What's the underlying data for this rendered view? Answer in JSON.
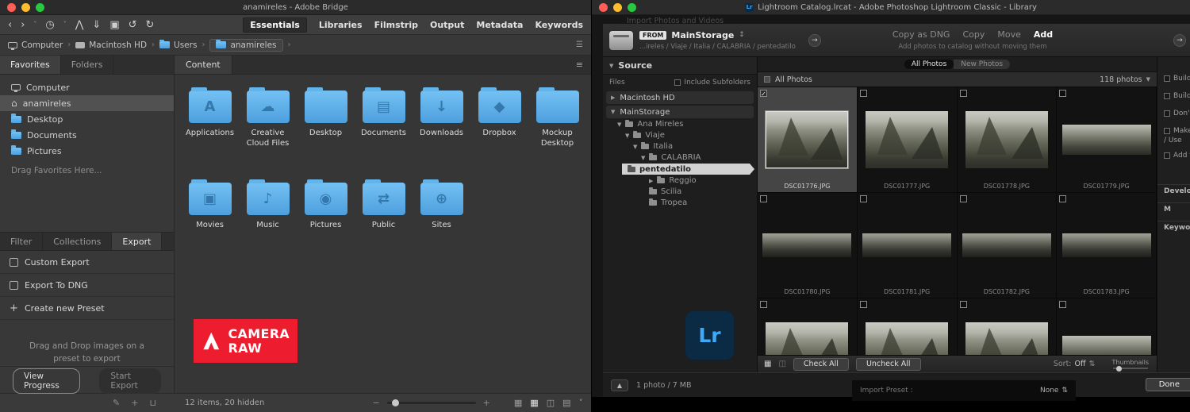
{
  "bridge": {
    "title": "anamireles - Adobe Bridge",
    "workspaces": [
      "Essentials",
      "Libraries",
      "Filmstrip",
      "Output",
      "Metadata",
      "Keywords"
    ],
    "breadcrumb": [
      "Computer",
      "Macintosh HD",
      "Users",
      "anamireles"
    ],
    "panel_tabs_top": [
      "Favorites",
      "Folders"
    ],
    "favorites": [
      {
        "label": "Computer"
      },
      {
        "label": "anamireles"
      },
      {
        "label": "Desktop"
      },
      {
        "label": "Documents"
      },
      {
        "label": "Pictures"
      }
    ],
    "favorites_hint": "Drag Favorites Here...",
    "panel_tabs_bottom": [
      "Filter",
      "Collections",
      "Export"
    ],
    "export_presets": [
      "Custom Export",
      "Export To DNG",
      "Create new Preset"
    ],
    "export_hint_line1": "Drag and Drop images on a",
    "export_hint_line2": "preset to export",
    "view_progress_label": "View Progress",
    "start_export_label": "Start Export",
    "content_tab_label": "Content",
    "folders": [
      {
        "label": "Applications",
        "glyph": "A"
      },
      {
        "label": "Creative Cloud Files",
        "glyph": "☁"
      },
      {
        "label": "Desktop",
        "glyph": ""
      },
      {
        "label": "Documents",
        "glyph": "▤"
      },
      {
        "label": "Downloads",
        "glyph": "↓"
      },
      {
        "label": "Dropbox",
        "glyph": "◆"
      },
      {
        "label": "Mockup Desktop",
        "glyph": ""
      },
      {
        "label": "Movies",
        "glyph": "▣"
      },
      {
        "label": "Music",
        "glyph": "♪"
      },
      {
        "label": "Pictures",
        "glyph": "◉"
      },
      {
        "label": "Public",
        "glyph": "⇄"
      },
      {
        "label": "Sites",
        "glyph": "⊕"
      }
    ],
    "camera_raw_line1": "CAMERA",
    "camera_raw_line2": "RAW",
    "status_text": "12 items, 20 hidden"
  },
  "lightroom": {
    "title": "Lightroom Catalog.lrcat - Adobe Photoshop Lightroom Classic - Library",
    "app_badge": "Lr",
    "dialog_caption": "Import Photos and Videos",
    "from_label": "FROM",
    "source_name": "MainStorage",
    "source_path": "...ireles / Viaje / Italia / CALABRIA / pentedatilo",
    "modes": [
      "Copy as DNG",
      "Copy",
      "Move",
      "Add"
    ],
    "active_mode": "Add",
    "mode_hint": "Add photos to catalog without moving them",
    "source": {
      "header": "Source",
      "files_label": "Files",
      "include_subfolders_label": "Include Subfolders",
      "volume1": "Macintosh HD",
      "volume2": "MainStorage",
      "tree": [
        "Ana Mireles",
        "Viaje",
        "Italia",
        "CALABRIA",
        "pentedatilo",
        "Reggio",
        "Scilia",
        "Tropea"
      ]
    },
    "grid": {
      "segment_all": "All Photos",
      "segment_new": "New Photos",
      "header_label": "All Photos",
      "photo_count": "118 photos",
      "photos": [
        "DSC01776.JPG",
        "DSC01777.JPG",
        "DSC01778.JPG",
        "DSC01779.JPG",
        "DSC01780.JPG",
        "DSC01781.JPG",
        "DSC01782.JPG",
        "DSC01783.JPG"
      ]
    },
    "toolbar": {
      "check_all_label": "Check All",
      "uncheck_all_label": "Uncheck All",
      "sort_label": "Sort:",
      "sort_value": "Off",
      "thumbnails_label": "Thumbnails"
    },
    "right_panel": [
      "Build",
      "Build",
      "Don't",
      "Make",
      "/ Use",
      "Add to",
      "Develop",
      "M",
      "Keywords"
    ],
    "footer": {
      "status_text": "1 photo / 7 MB",
      "preset_label": "Import Preset :",
      "preset_value": "None",
      "done_label": "Done"
    }
  }
}
